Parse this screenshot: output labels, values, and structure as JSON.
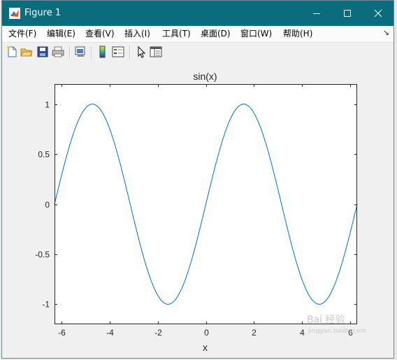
{
  "window": {
    "title": "Figure 1"
  },
  "menu": [
    "文件(F)",
    "编辑(E)",
    "查看(V)",
    "插入(I)",
    "工具(T)",
    "桌面(D)",
    "窗口(W)",
    "帮助(H)"
  ],
  "toolbar_icons": [
    "new-figure-icon",
    "open-file-icon",
    "save-icon",
    "print-icon",
    "link-plot-icon",
    "colorbar-icon",
    "legend-icon",
    "edit-plot-arrow-icon",
    "property-inspector-icon"
  ],
  "colors": {
    "titlebar": "#0a6c7d",
    "line": "#0072bd",
    "axes_bg": "#ffffff",
    "figure_bg": "#f0f0f0"
  },
  "watermark": {
    "main": "Bai 经验",
    "sub": "jingyan.baidu.com"
  },
  "chart_data": {
    "type": "line",
    "title": "sin(x)",
    "xlabel": "x",
    "ylabel": "",
    "xlim": [
      -6.2832,
      6.2832
    ],
    "ylim": [
      -1.2,
      1.2
    ],
    "xticks": [
      -6,
      -4,
      -2,
      0,
      2,
      4,
      6
    ],
    "xtick_labels": [
      "-6",
      "-4",
      "-2",
      "0",
      "2",
      "4",
      "6"
    ],
    "yticks": [
      1,
      0.5,
      0,
      -0.5,
      -1
    ],
    "ytick_labels": [
      "1",
      "0.5",
      "0",
      "-0.5",
      "-1"
    ],
    "grid": false,
    "series": [
      {
        "function": "sin(x)",
        "x": [
          -6.2832,
          -5.7596,
          -5.236,
          -4.7124,
          -4.1888,
          -3.6652,
          -3.1416,
          -2.618,
          -2.0944,
          -1.5708,
          -1.0472,
          -0.5236,
          0,
          0.5236,
          1.0472,
          1.5708,
          2.0944,
          2.618,
          3.1416,
          3.6652,
          4.1888,
          4.7124,
          5.236,
          5.7596,
          6.2832
        ],
        "y": [
          0,
          0.5,
          0.866,
          1,
          0.866,
          0.5,
          0,
          -0.5,
          -0.866,
          -1,
          -0.866,
          -0.5,
          0,
          0.5,
          0.866,
          1,
          0.866,
          0.5,
          0,
          -0.5,
          -0.866,
          -1,
          -0.866,
          -0.5,
          0
        ]
      }
    ]
  }
}
